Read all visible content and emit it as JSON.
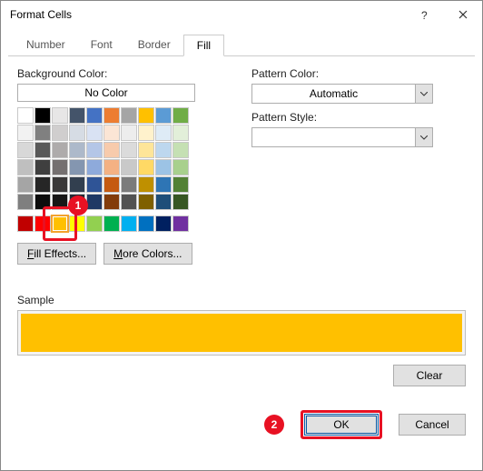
{
  "title": "Format Cells",
  "tabs": [
    "Number",
    "Font",
    "Border",
    "Fill"
  ],
  "active_tab_index": 3,
  "fill": {
    "bg_label": "Background Color:",
    "no_color": "No Color",
    "fill_effects": "Fill Effects...",
    "more_colors": "More Colors...",
    "theme_palette": [
      [
        "#ffffff",
        "#000000",
        "#e7e6e6",
        "#44546a",
        "#4472c4",
        "#ed7d31",
        "#a5a5a5",
        "#ffc000",
        "#5b9bd5",
        "#70ad47"
      ],
      [
        "#f2f2f2",
        "#808080",
        "#d0cece",
        "#d6dce4",
        "#d9e2f3",
        "#fbe5d5",
        "#ededed",
        "#fff2cc",
        "#deebf6",
        "#e2efd9"
      ],
      [
        "#d8d8d8",
        "#595959",
        "#aeabab",
        "#adb9ca",
        "#b4c6e7",
        "#f7cbac",
        "#dbdbdb",
        "#fee599",
        "#bdd7ee",
        "#c5e0b3"
      ],
      [
        "#bfbfbf",
        "#3f3f3f",
        "#757070",
        "#8496b0",
        "#8eaadb",
        "#f4b183",
        "#c9c9c9",
        "#ffd965",
        "#9cc3e5",
        "#a8d08d"
      ],
      [
        "#a5a5a5",
        "#262626",
        "#3a3838",
        "#323f4f",
        "#2f5496",
        "#c55a11",
        "#7b7b7b",
        "#bf9000",
        "#2e75b5",
        "#538135"
      ],
      [
        "#7f7f7f",
        "#0d0d0d",
        "#171616",
        "#222a35",
        "#1f3864",
        "#833c0b",
        "#525252",
        "#7f6000",
        "#1e4e79",
        "#375623"
      ]
    ],
    "standard_colors": [
      "#c00000",
      "#ff0000",
      "#ffc000",
      "#ffff00",
      "#92d050",
      "#00b050",
      "#00b0f0",
      "#0070c0",
      "#002060",
      "#7030a0"
    ],
    "selected_standard_index": 2,
    "selected_color": "#ffc000"
  },
  "pattern": {
    "color_label": "Pattern Color:",
    "color_value": "Automatic",
    "style_label": "Pattern Style:"
  },
  "sample_label": "Sample",
  "buttons": {
    "clear": "Clear",
    "ok": "OK",
    "cancel": "Cancel"
  },
  "annotations": {
    "one": "1",
    "two": "2"
  }
}
